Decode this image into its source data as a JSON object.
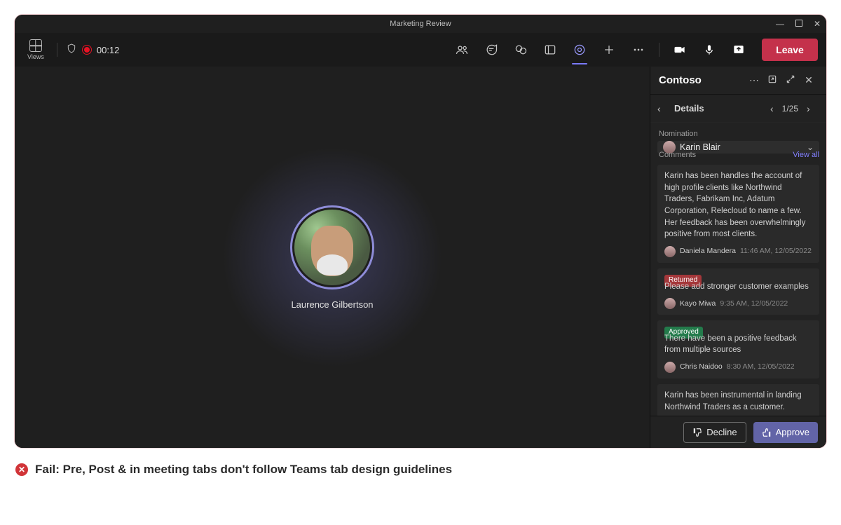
{
  "window": {
    "title": "Marketing Review"
  },
  "toolbar": {
    "views_label": "Views",
    "timer": "00:12",
    "leave_label": "Leave"
  },
  "stage": {
    "participant_name": "Laurence Gilbertson"
  },
  "panel": {
    "title": "Contoso",
    "nav": {
      "details_label": "Details",
      "pager": "1/25"
    },
    "nomination_caption": "Nomination",
    "nominee": {
      "name": "Karin Blair"
    },
    "comments_label": "Comments",
    "view_all_label": "View all",
    "comments": [
      {
        "badge": "",
        "text": "Karin has been handles the account of high profile clients like Northwind Traders, Fabrikam Inc, Adatum Corporation, Relecloud to name a few. Her feedback has been overwhelmingly positive from most clients.",
        "author": "Daniela Mandera",
        "time": "11:46 AM, 12/05/2022"
      },
      {
        "badge": "Returned",
        "text": "Please add stronger customer examples",
        "author": "Kayo Miwa",
        "time": "9:35 AM, 12/05/2022"
      },
      {
        "badge": "Approved",
        "text": "There have been a positive feedback from multiple sources",
        "author": "Chris Naidoo",
        "time": "8:30 AM, 12/05/2022"
      },
      {
        "badge": "",
        "text": "Karin has been instrumental in landing Northwind Traders as a customer.",
        "author": "",
        "time": ""
      }
    ],
    "decline_label": "Decline",
    "approve_label": "Approve"
  },
  "caption": {
    "text": "Fail: Pre, Post & in meeting tabs don't follow Teams tab design guidelines"
  }
}
